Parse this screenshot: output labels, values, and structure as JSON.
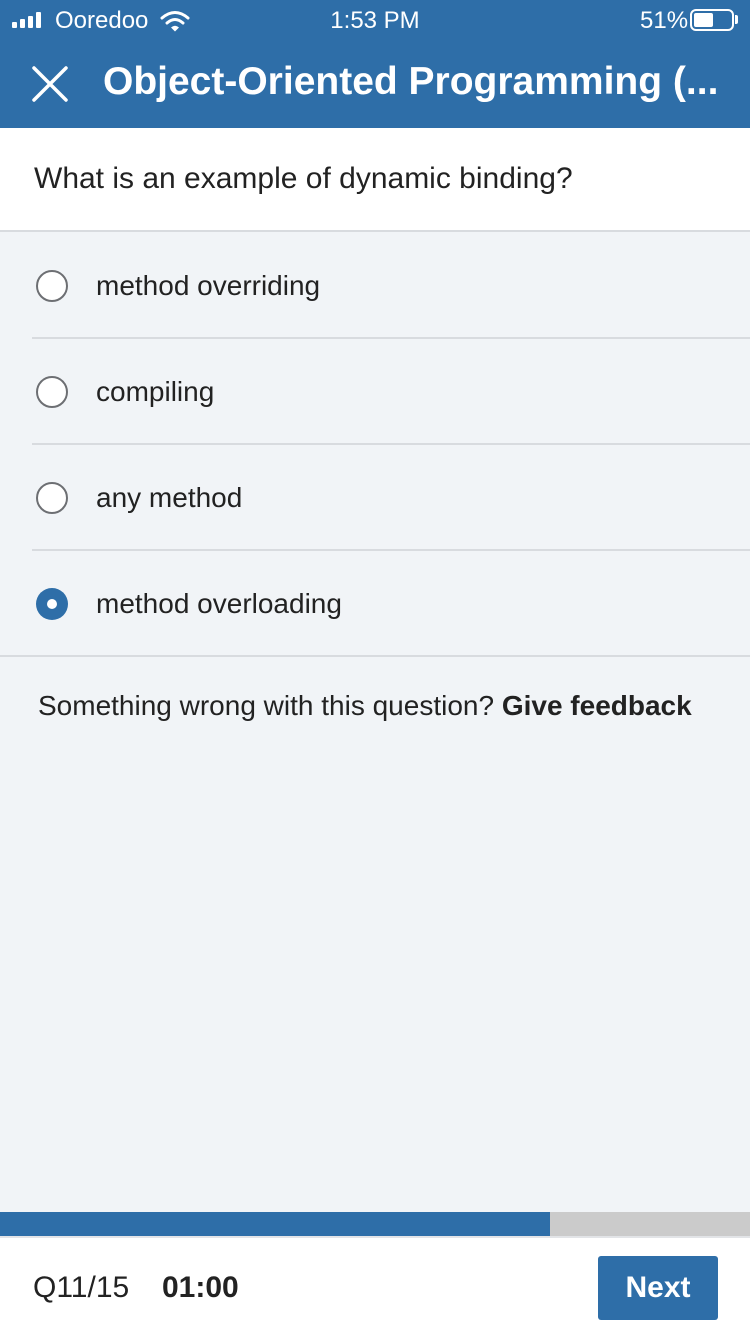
{
  "status_bar": {
    "carrier": "Ooredoo",
    "time": "1:53 PM",
    "battery_percent": "51%",
    "battery_level": 0.51,
    "icons": [
      "signal-icon",
      "wifi-icon",
      "battery-icon"
    ]
  },
  "header": {
    "close_icon": "close-icon",
    "title": "Object-Oriented Programming (..."
  },
  "question": {
    "text": "What is an example of dynamic binding?"
  },
  "options": [
    {
      "label": "method overriding",
      "selected": false
    },
    {
      "label": "compiling",
      "selected": false
    },
    {
      "label": "any method",
      "selected": false
    },
    {
      "label": "method overloading",
      "selected": true
    }
  ],
  "feedback": {
    "prompt": "Something wrong with this question?",
    "link": "Give feedback"
  },
  "progress": {
    "fraction": 0.733,
    "colors": {
      "fill": "#2e6ea8",
      "track": "#cbcbcb"
    }
  },
  "footer": {
    "question_counter": "Q11/15",
    "timer": "01:00",
    "next_label": "Next"
  },
  "colors": {
    "accent": "#2e6ea8",
    "background": "#f1f4f7"
  }
}
